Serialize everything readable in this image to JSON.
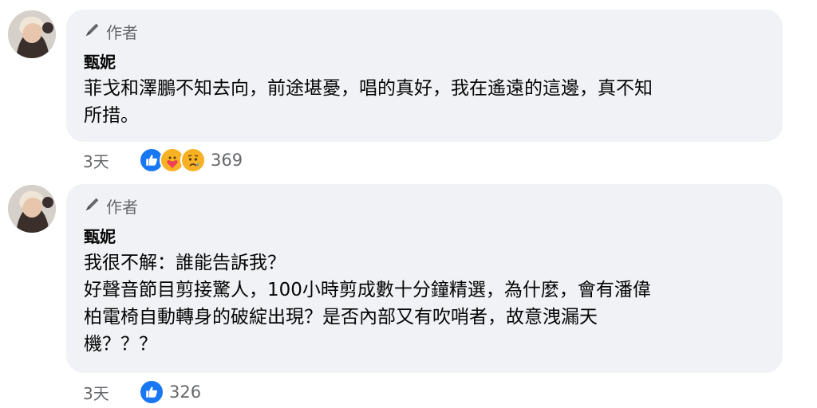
{
  "comments": [
    {
      "author_badge": "作者",
      "name": "甄妮",
      "lines": [
        "菲戈和澤鵬不知去向，前途堪憂，唱的真好，我在遙遠的這邊，真不知",
        "所措。"
      ],
      "time": "3天",
      "reactions": [
        "like-icon",
        "care-icon",
        "sad-icon"
      ],
      "reaction_count": "369"
    },
    {
      "author_badge": "作者",
      "name": "甄妮",
      "lines": [
        "我很不解：誰能告訴我？",
        "好聲音節目剪接驚人，100小時剪成數十分鐘精選，為什麼，會有潘偉",
        "柏電椅自動轉身的破綻出現？是否內部又有吹哨者，故意洩漏天",
        "機？？？"
      ],
      "time": "3天",
      "reactions": [
        "like-icon"
      ],
      "reaction_count": "326"
    }
  ],
  "colors": {
    "bubble": "#f0f2f5",
    "secondary_text": "#65676b",
    "like_blue": "#1877f2",
    "care_yellow": "#f7b125",
    "heart_red": "#f33e58"
  }
}
